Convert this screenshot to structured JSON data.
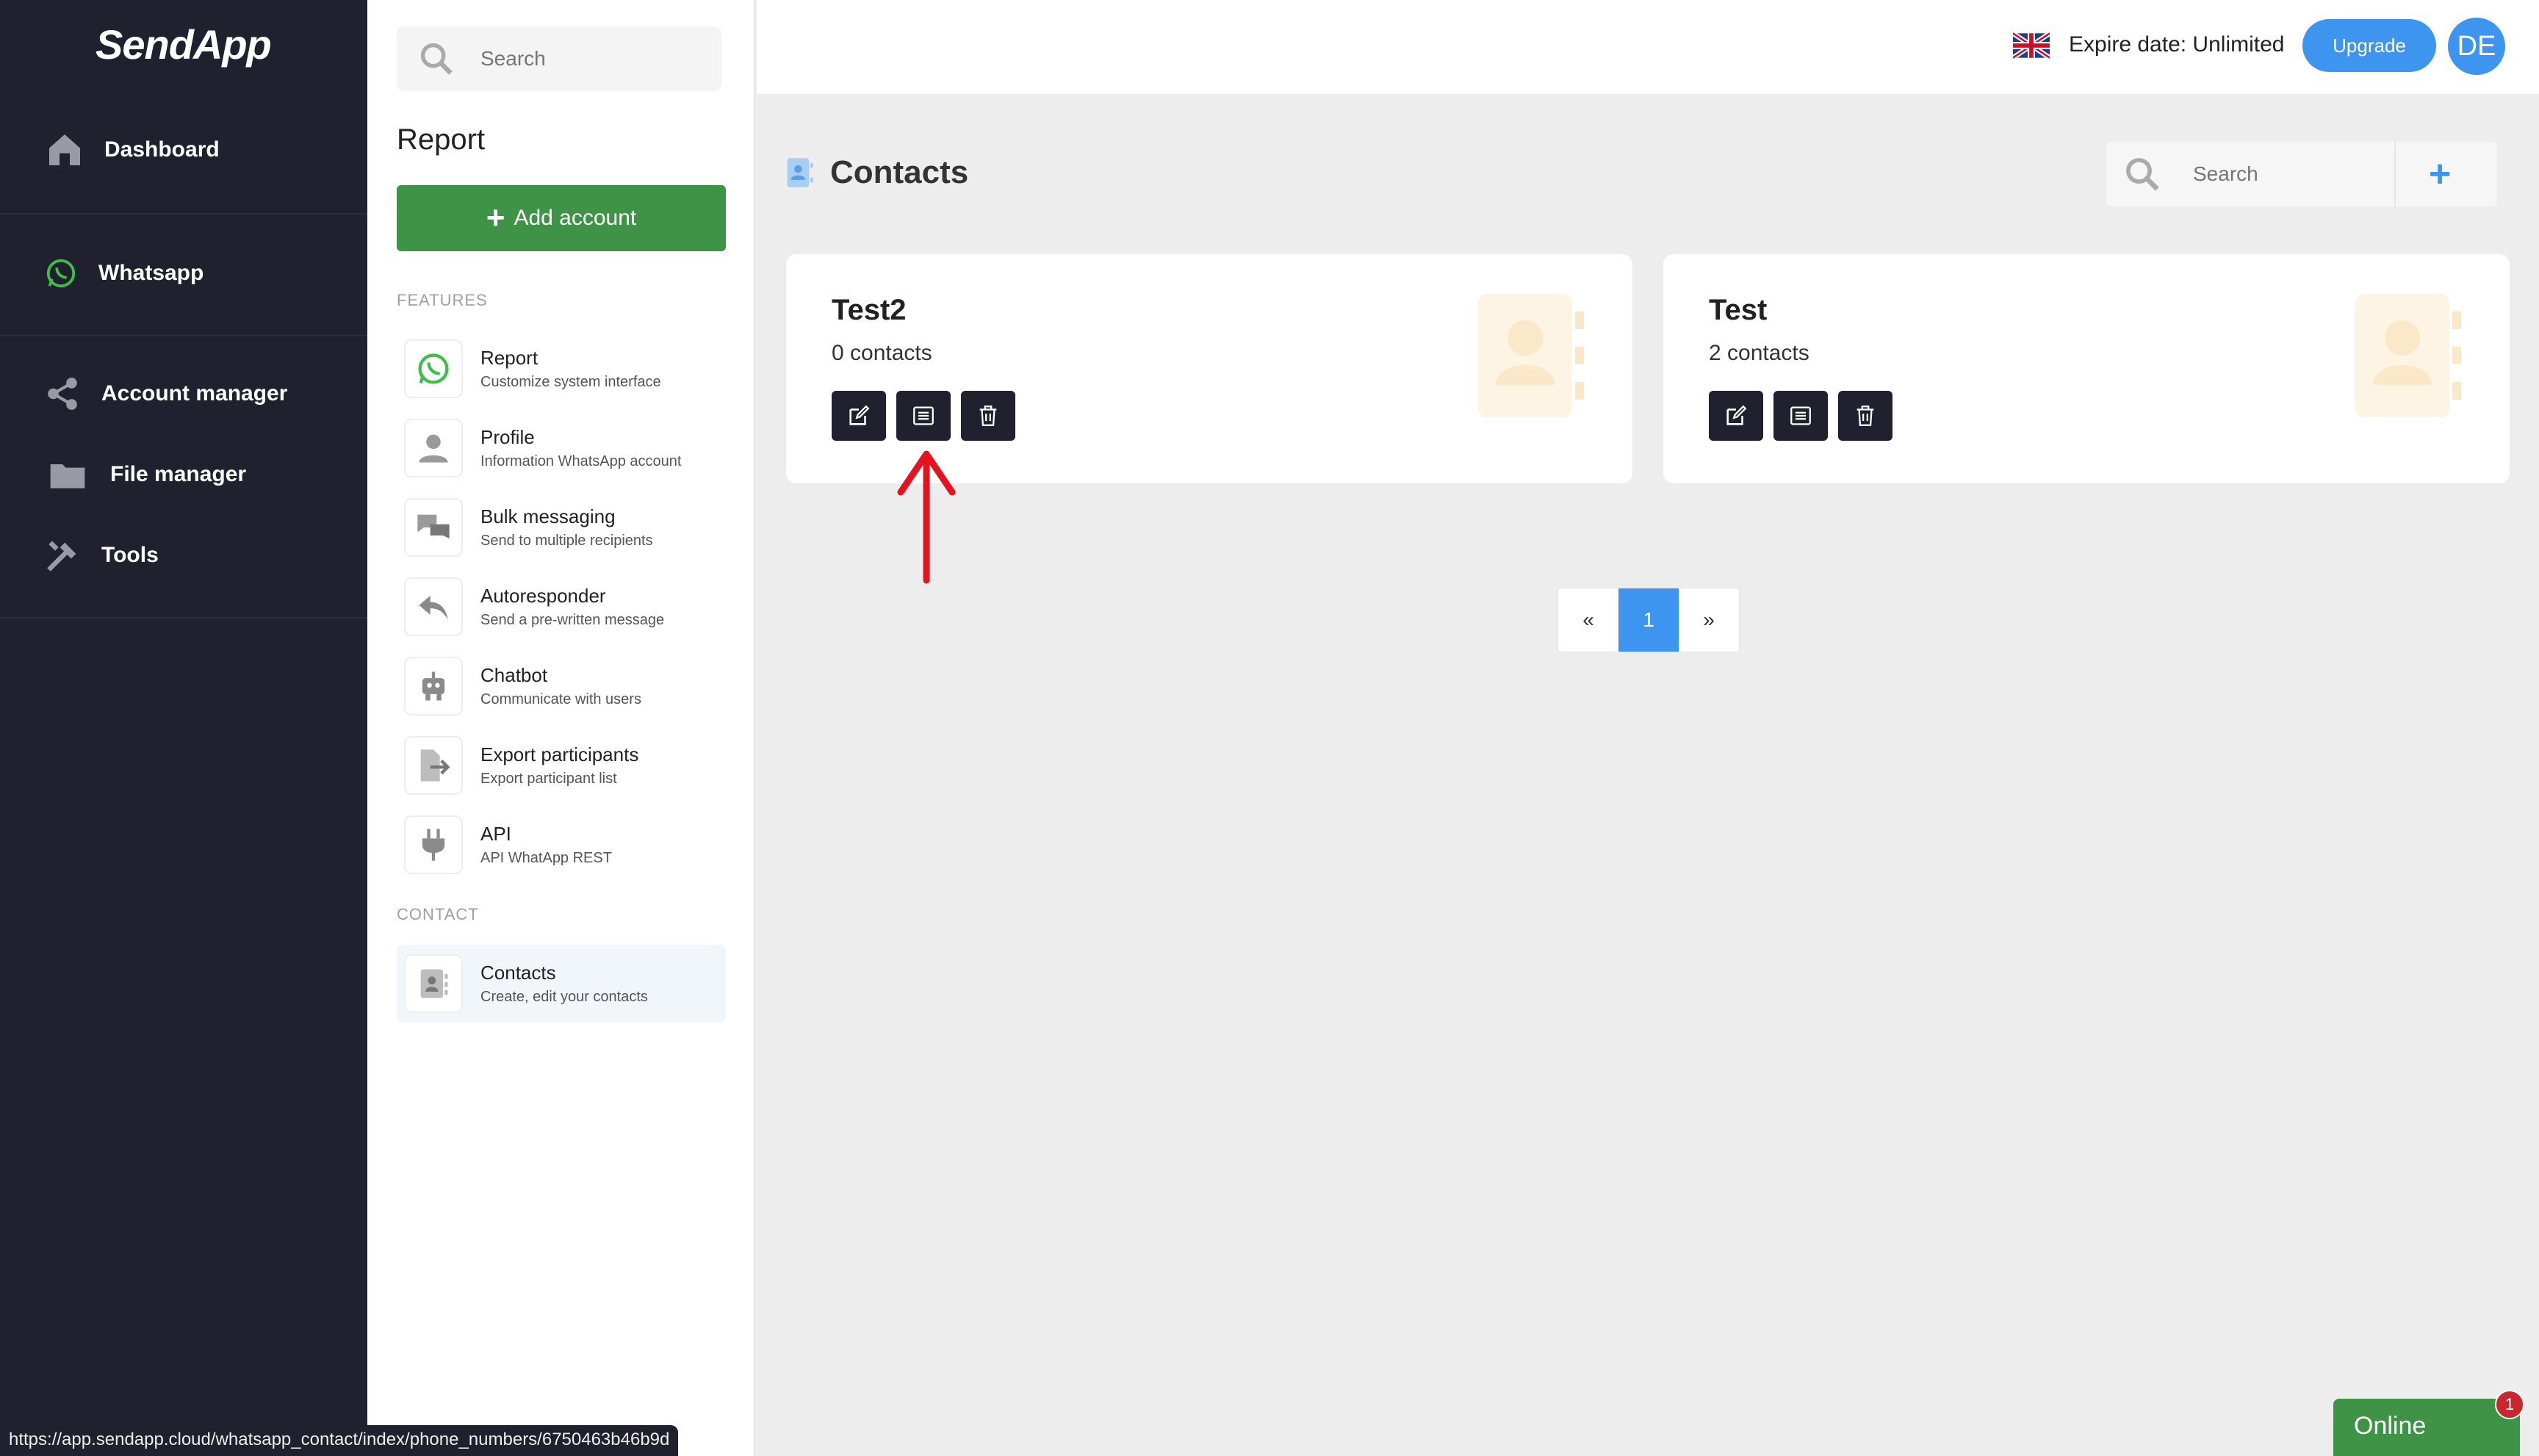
{
  "app": {
    "logo": "SendApp"
  },
  "nav": {
    "items": [
      {
        "label": "Dashboard"
      },
      {
        "label": "Whatsapp"
      },
      {
        "label": "Account manager"
      },
      {
        "label": "File manager"
      },
      {
        "label": "Tools"
      }
    ]
  },
  "panel": {
    "search_placeholder": "Search",
    "title": "Report",
    "add_button": "Add account",
    "features_label": "FEATURES",
    "features": [
      {
        "title": "Report",
        "subtitle": "Customize system interface"
      },
      {
        "title": "Profile",
        "subtitle": "Information WhatsApp account"
      },
      {
        "title": "Bulk messaging",
        "subtitle": "Send to multiple recipients"
      },
      {
        "title": "Autoresponder",
        "subtitle": "Send a pre-written message"
      },
      {
        "title": "Chatbot",
        "subtitle": "Communicate with users"
      },
      {
        "title": "Export participants",
        "subtitle": "Export participant list"
      },
      {
        "title": "API",
        "subtitle": "API WhatApp REST"
      }
    ],
    "contact_label": "CONTACT",
    "contact": {
      "title": "Contacts",
      "subtitle": "Create, edit your contacts"
    }
  },
  "topbar": {
    "expire": "Expire date: Unlimited",
    "upgrade": "Upgrade",
    "avatar": "DE"
  },
  "main": {
    "title": "Contacts",
    "search_placeholder": "Search",
    "cards": [
      {
        "name": "Test2",
        "count": "0 contacts"
      },
      {
        "name": "Test",
        "count": "2 contacts"
      }
    ],
    "pager": {
      "prev": "«",
      "current": "1",
      "next": "»"
    }
  },
  "status_url": "https://app.sendapp.cloud/whatsapp_contact/index/phone_numbers/6750463b46b9d",
  "online": {
    "label": "Online",
    "badge": "1"
  },
  "colors": {
    "nav_bg": "#20202f",
    "green": "#3f9347",
    "blue": "#3d95f0",
    "arrow": "#e8121f"
  }
}
